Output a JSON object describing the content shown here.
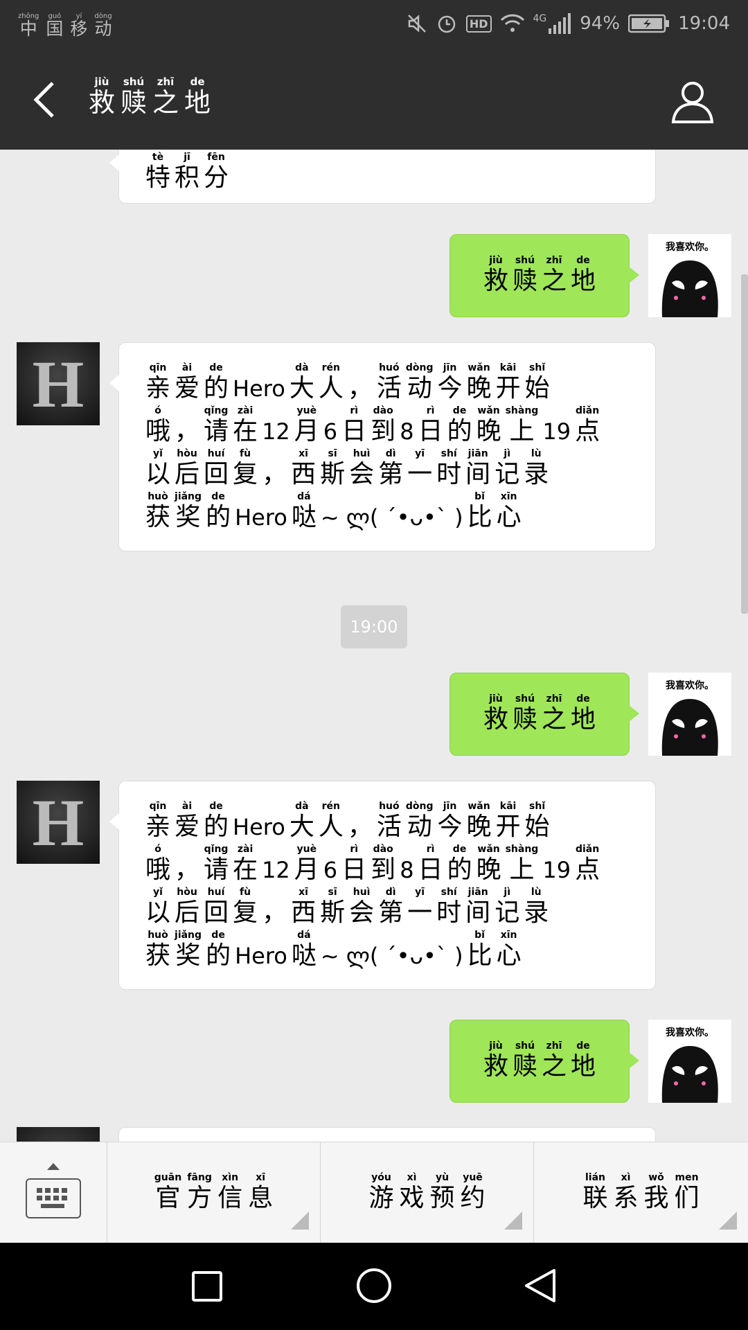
{
  "status_bar": {
    "carrier": [
      {
        "py": "zhōng",
        "ch": "中"
      },
      {
        "py": "guó",
        "ch": "国"
      },
      {
        "py": "yí",
        "ch": "移"
      },
      {
        "py": "dòng",
        "ch": "动"
      }
    ],
    "network": "4G",
    "battery": "94%",
    "time": "19:04"
  },
  "header": {
    "back_icon": "chevron-left-icon",
    "title": [
      {
        "py": "jiù",
        "ch": "救"
      },
      {
        "py": "shú",
        "ch": "赎"
      },
      {
        "py": "zhī",
        "ch": "之"
      },
      {
        "py": "de",
        "ch": "地"
      }
    ],
    "profile_icon": "person-icon"
  },
  "chat": {
    "partial_top": [
      {
        "py": "tè",
        "ch": "特"
      },
      {
        "py": "jī",
        "ch": "积"
      },
      {
        "py": "fēn",
        "ch": "分"
      }
    ],
    "sent_message": [
      {
        "py": "jiù",
        "ch": "救"
      },
      {
        "py": "shú",
        "ch": "赎"
      },
      {
        "py": "zhī",
        "ch": "之"
      },
      {
        "py": "de",
        "ch": "地"
      }
    ],
    "sticker_caption": "我喜欢你。",
    "avatar_letter": "H",
    "reply_lines": [
      [
        {
          "py": "qīn",
          "ch": "亲"
        },
        {
          "py": "ài",
          "ch": "爱"
        },
        {
          "py": "de",
          "ch": "的"
        },
        {
          "t": "Hero"
        },
        {
          "py": "dà",
          "ch": "大"
        },
        {
          "py": "rén",
          "ch": "人"
        },
        {
          "py": "",
          "ch": "，"
        },
        {
          "py": "huó",
          "ch": "活"
        },
        {
          "py": "dòng",
          "ch": "动"
        },
        {
          "py": "jīn",
          "ch": "今"
        },
        {
          "py": "wǎn",
          "ch": "晚"
        },
        {
          "py": "kāi",
          "ch": "开"
        },
        {
          "py": "shǐ",
          "ch": "始"
        }
      ],
      [
        {
          "py": "ó",
          "ch": "哦"
        },
        {
          "py": "",
          "ch": "，"
        },
        {
          "py": "qǐng",
          "ch": "请"
        },
        {
          "py": "zài",
          "ch": "在"
        },
        {
          "t": "12"
        },
        {
          "py": "yuè",
          "ch": "月"
        },
        {
          "t": "6"
        },
        {
          "py": "rì",
          "ch": "日"
        },
        {
          "py": "dào",
          "ch": "到"
        },
        {
          "t": "8"
        },
        {
          "py": "rì",
          "ch": "日"
        },
        {
          "py": "de",
          "ch": "的"
        },
        {
          "py": "wǎn",
          "ch": "晚"
        },
        {
          "py": "shàng",
          "ch": "上"
        },
        {
          "t": "19"
        },
        {
          "py": "diǎn",
          "ch": "点"
        }
      ],
      [
        {
          "py": "yǐ",
          "ch": "以"
        },
        {
          "py": "hòu",
          "ch": "后"
        },
        {
          "py": "huí",
          "ch": "回"
        },
        {
          "py": "fù",
          "ch": "复"
        },
        {
          "py": "",
          "ch": "，"
        },
        {
          "py": "xī",
          "ch": "西"
        },
        {
          "py": "sī",
          "ch": "斯"
        },
        {
          "py": "huì",
          "ch": "会"
        },
        {
          "py": "dì",
          "ch": "第"
        },
        {
          "py": "yī",
          "ch": "一"
        },
        {
          "py": "shí",
          "ch": "时"
        },
        {
          "py": "jiān",
          "ch": "间"
        },
        {
          "py": "jì",
          "ch": "记"
        },
        {
          "py": "lù",
          "ch": "录"
        }
      ],
      [
        {
          "py": "huò",
          "ch": "获"
        },
        {
          "py": "jiǎng",
          "ch": "奖"
        },
        {
          "py": "de",
          "ch": "的"
        },
        {
          "t": "Hero"
        },
        {
          "py": "dá",
          "ch": "哒"
        },
        {
          "t": "~ ლ( ´•ᴗ•` )"
        },
        {
          "py": "bǐ",
          "ch": "比"
        },
        {
          "py": "xīn",
          "ch": "心"
        }
      ]
    ],
    "timestamp": "19:00"
  },
  "menu": {
    "keyboard_icon": "keyboard-icon",
    "items": [
      [
        {
          "py": "guān",
          "ch": "官"
        },
        {
          "py": "fāng",
          "ch": "方"
        },
        {
          "py": "xìn",
          "ch": "信"
        },
        {
          "py": "xī",
          "ch": "息"
        }
      ],
      [
        {
          "py": "yóu",
          "ch": "游"
        },
        {
          "py": "xì",
          "ch": "戏"
        },
        {
          "py": "yù",
          "ch": "预"
        },
        {
          "py": "yuē",
          "ch": "约"
        }
      ],
      [
        {
          "py": "lián",
          "ch": "联"
        },
        {
          "py": "xì",
          "ch": "系"
        },
        {
          "py": "wǒ",
          "ch": "我"
        },
        {
          "py": "men",
          "ch": "们"
        }
      ]
    ]
  },
  "nav": {
    "square_icon": "recents-icon",
    "circle_icon": "home-icon",
    "triangle_icon": "back-icon"
  }
}
